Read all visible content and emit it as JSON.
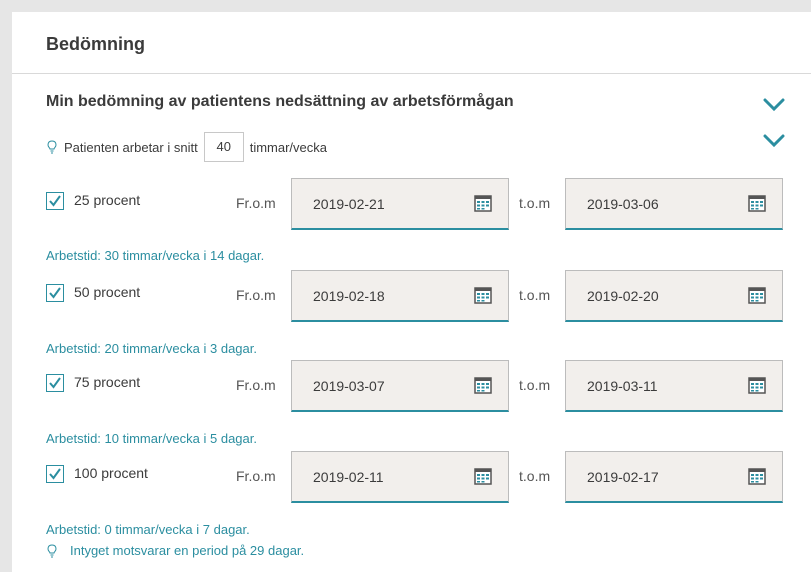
{
  "header": {
    "title": "Bedömning"
  },
  "section": {
    "title": "Min bedömning av patientens nedsättning av arbetsförmågan"
  },
  "hours": {
    "prefix": "Patienten arbetar i snitt",
    "value": "40",
    "suffix": "timmar/vecka"
  },
  "periods": [
    {
      "checked": true,
      "label": "25 procent",
      "from_label": "Fr.o.m",
      "from": "2019-02-21",
      "to_label": "t.o.m",
      "to": "2019-03-06",
      "worktime": "Arbetstid: 30 timmar/vecka i 14 dagar."
    },
    {
      "checked": true,
      "label": "50 procent",
      "from_label": "Fr.o.m",
      "from": "2019-02-18",
      "to_label": "t.o.m",
      "to": "2019-02-20",
      "worktime": "Arbetstid: 20 timmar/vecka i 3 dagar."
    },
    {
      "checked": true,
      "label": "75 procent",
      "from_label": "Fr.o.m",
      "from": "2019-03-07",
      "to_label": "t.o.m",
      "to": "2019-03-11",
      "worktime": "Arbetstid: 10 timmar/vecka i 5 dagar."
    },
    {
      "checked": true,
      "label": "100 procent",
      "from_label": "Fr.o.m",
      "from": "2019-02-11",
      "to_label": "t.o.m",
      "to": "2019-02-17",
      "worktime": "Arbetstid: 0 timmar/vecka i 7 dagar."
    }
  ],
  "summary": "Intyget motsvarar en period på 29 dagar.",
  "icons": {
    "expand": "chevron-down-icon",
    "info": "lightbulb-icon",
    "calendar": "calendar-icon"
  },
  "colors": {
    "accent": "#2b8ea0",
    "field_bg": "#f2efec"
  }
}
